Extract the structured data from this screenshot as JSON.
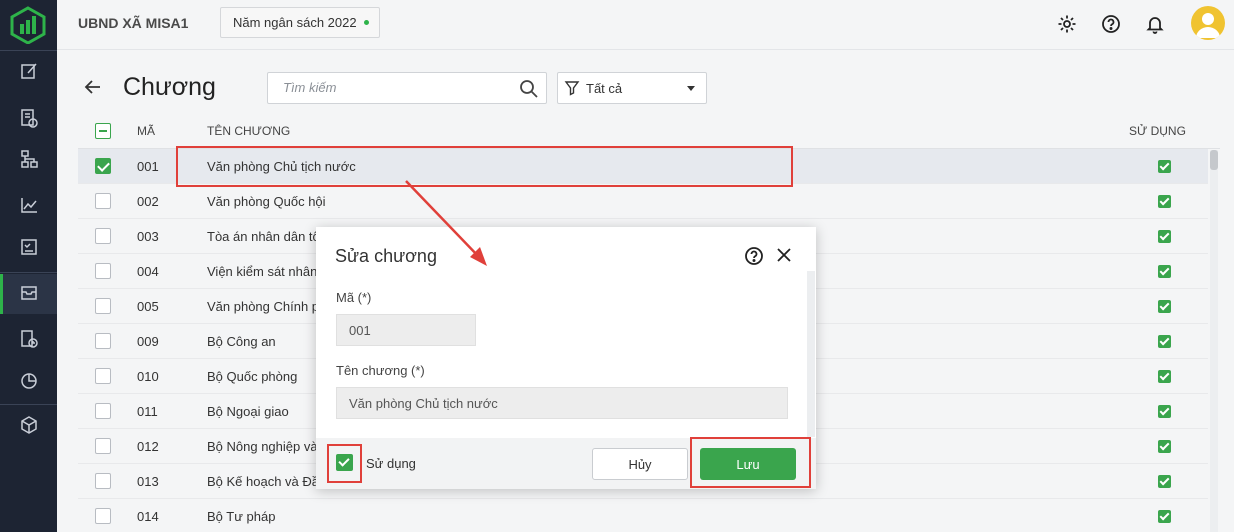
{
  "header": {
    "org_name": "UBND XÃ MISA1",
    "budget_year": "Năm ngân sách 2022"
  },
  "page": {
    "title": "Chương",
    "search_placeholder": "Tìm kiếm",
    "filter_label": "Tất cả"
  },
  "table": {
    "col_code": "MÃ",
    "col_name": "TÊN CHƯƠNG",
    "col_use": "SỬ DỤNG",
    "rows": [
      {
        "code": "001",
        "name": "Văn phòng Chủ tịch nước"
      },
      {
        "code": "002",
        "name": "Văn phòng Quốc hội"
      },
      {
        "code": "003",
        "name": "Tòa án nhân dân tố"
      },
      {
        "code": "004",
        "name": "Viện kiểm sát nhân"
      },
      {
        "code": "005",
        "name": "Văn phòng Chính p"
      },
      {
        "code": "009",
        "name": "Bộ Công an"
      },
      {
        "code": "010",
        "name": "Bộ Quốc phòng"
      },
      {
        "code": "011",
        "name": "Bộ Ngoại giao"
      },
      {
        "code": "012",
        "name": "Bộ Nông nghiệp và"
      },
      {
        "code": "013",
        "name": "Bộ Kế hoạch và Đầ"
      },
      {
        "code": "014",
        "name": "Bộ Tư pháp"
      }
    ]
  },
  "dialog": {
    "title": "Sửa chương",
    "code_label": "Mã (*)",
    "code_value": "001",
    "name_label": "Tên chương (*)",
    "name_value": "Văn phòng Chủ tịch nước",
    "use_label": "Sử dụng",
    "cancel_label": "Hủy",
    "save_label": "Lưu"
  },
  "colors": {
    "sidebar": "#1d2433",
    "accent_green": "#3aa54d",
    "annotation_red": "#e0403a",
    "avatar": "#f0c330"
  }
}
